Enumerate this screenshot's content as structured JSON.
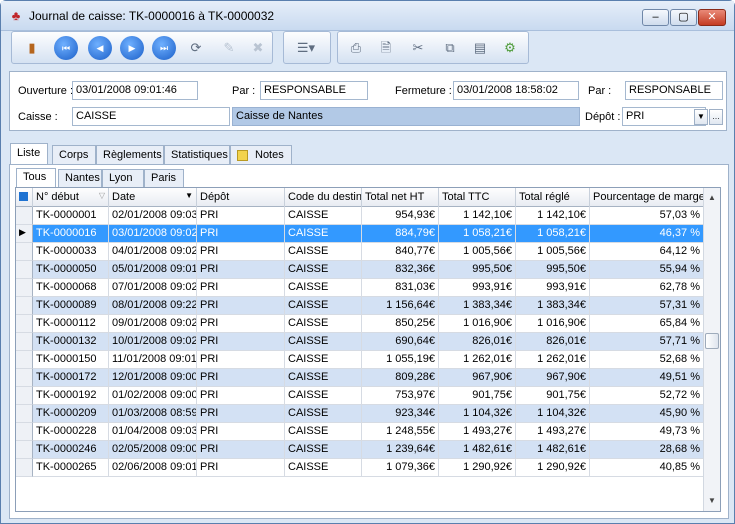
{
  "window": {
    "title": "Journal de caisse: TK-0000016 à TK-0000032",
    "minimize": "–",
    "maximize": "▢",
    "close": "✕"
  },
  "toolbar": {
    "icons": [
      "door-icon",
      "first-record-icon",
      "previous-record-icon",
      "next-record-icon",
      "last-record-icon",
      "refresh-icon",
      "edit-icon",
      "delete-icon",
      "list-menu-icon",
      "print-icon",
      "preview-icon",
      "print-settings-icon",
      "export-icon",
      "document-icon",
      "tools-icon"
    ]
  },
  "fields": {
    "ouverture_label": "Ouverture :",
    "ouverture_value": "03/01/2008 09:01:46",
    "par1_label": "Par :",
    "par1_value": "RESPONSABLE",
    "fermeture_label": "Fermeture :",
    "fermeture_value": "03/01/2008 18:58:02",
    "par2_label": "Par :",
    "par2_value": "RESPONSABLE",
    "caisse_label": "Caisse :",
    "caisse_value": "CAISSE",
    "caisse_name": "Caisse de Nantes",
    "depot_label": "Dépôt :",
    "depot_value": "PRI"
  },
  "tabs": [
    "Liste",
    "Corps",
    "Règlements",
    "Statistiques",
    "Notes"
  ],
  "subtabs": [
    "Tous",
    "Nantes",
    "Lyon",
    "Paris"
  ],
  "grid": {
    "columns": [
      "N° début",
      "Date",
      "Dépôt",
      "Code du destin",
      "Total net HT",
      "Total TTC",
      "Total réglé",
      "Pourcentage de marge"
    ],
    "rows": [
      [
        "TK-0000001",
        "02/01/2008 09:03",
        "PRI",
        "CAISSE",
        "954,93€",
        "1 142,10€",
        "1 142,10€",
        "57,03 %"
      ],
      [
        "TK-0000016",
        "03/01/2008 09:02",
        "PRI",
        "CAISSE",
        "884,79€",
        "1 058,21€",
        "1 058,21€",
        "46,37 %"
      ],
      [
        "TK-0000033",
        "04/01/2008 09:02",
        "PRI",
        "CAISSE",
        "840,77€",
        "1 005,56€",
        "1 005,56€",
        "64,12 %"
      ],
      [
        "TK-0000050",
        "05/01/2008 09:01",
        "PRI",
        "CAISSE",
        "832,36€",
        "995,50€",
        "995,50€",
        "55,94 %"
      ],
      [
        "TK-0000068",
        "07/01/2008 09:02",
        "PRI",
        "CAISSE",
        "831,03€",
        "993,91€",
        "993,91€",
        "62,78 %"
      ],
      [
        "TK-0000089",
        "08/01/2008 09:22",
        "PRI",
        "CAISSE",
        "1 156,64€",
        "1 383,34€",
        "1 383,34€",
        "57,31 %"
      ],
      [
        "TK-0000112",
        "09/01/2008 09:02",
        "PRI",
        "CAISSE",
        "850,25€",
        "1 016,90€",
        "1 016,90€",
        "65,84 %"
      ],
      [
        "TK-0000132",
        "10/01/2008 09:02",
        "PRI",
        "CAISSE",
        "690,64€",
        "826,01€",
        "826,01€",
        "57,71 %"
      ],
      [
        "TK-0000150",
        "11/01/2008 09:01",
        "PRI",
        "CAISSE",
        "1 055,19€",
        "1 262,01€",
        "1 262,01€",
        "52,68 %"
      ],
      [
        "TK-0000172",
        "12/01/2008 09:00",
        "PRI",
        "CAISSE",
        "809,28€",
        "967,90€",
        "967,90€",
        "49,51 %"
      ],
      [
        "TK-0000192",
        "01/02/2008 09:00",
        "PRI",
        "CAISSE",
        "753,97€",
        "901,75€",
        "901,75€",
        "52,72 %"
      ],
      [
        "TK-0000209",
        "01/03/2008 08:59",
        "PRI",
        "CAISSE",
        "923,34€",
        "1 104,32€",
        "1 104,32€",
        "45,90 %"
      ],
      [
        "TK-0000228",
        "01/04/2008 09:03",
        "PRI",
        "CAISSE",
        "1 248,55€",
        "1 493,27€",
        "1 493,27€",
        "49,73 %"
      ],
      [
        "TK-0000246",
        "02/05/2008 09:00",
        "PRI",
        "CAISSE",
        "1 239,64€",
        "1 482,61€",
        "1 482,61€",
        "28,68 %"
      ],
      [
        "TK-0000265",
        "02/06/2008 09:01",
        "PRI",
        "CAISSE",
        "1 079,36€",
        "1 290,92€",
        "1 290,92€",
        "40,85 %"
      ]
    ],
    "selected_row": 1
  },
  "colors": {
    "selection": "#3399ff",
    "alternate_row": "#d3e1f4"
  }
}
